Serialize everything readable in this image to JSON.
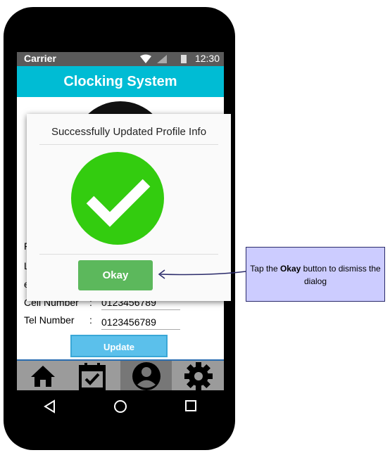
{
  "statusbar": {
    "carrier": "Carrier",
    "time": "12:30"
  },
  "app": {
    "title": "Clocking System"
  },
  "form": {
    "partial_labels": [
      "F",
      "L",
      "e"
    ],
    "cell_label": "Cell Number",
    "cell_colon": ":",
    "cell_value": "0123456789",
    "tel_label": "Tel Number",
    "tel_colon": ":",
    "tel_value": "0123456789",
    "update_label": "Update"
  },
  "dialog": {
    "title": "Successfully Updated Profile Info",
    "okay_label": "Okay",
    "icon": "check-circle-icon",
    "icon_color": "#33cc0f"
  },
  "bottom_nav": [
    {
      "icon": "home-icon",
      "active": false
    },
    {
      "icon": "calendar-check-icon",
      "active": false
    },
    {
      "icon": "profile-icon",
      "active": true
    },
    {
      "icon": "gear-icon",
      "active": false
    }
  ],
  "annotation": {
    "before": "Tap the ",
    "bold": "Okay",
    "after": " button to dismiss the dialog"
  },
  "colors": {
    "appbar": "#00bcd4",
    "okay": "#5cb85c",
    "update": "#5bc0eb",
    "note_bg": "#ccccff"
  }
}
